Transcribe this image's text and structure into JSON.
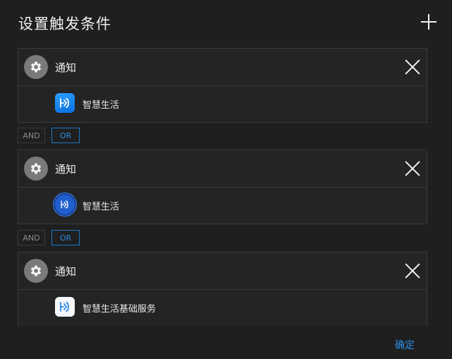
{
  "dialog": {
    "title": "设置触发条件",
    "add_icon": "plus-icon"
  },
  "logic_labels": {
    "and": "AND",
    "or": "OR",
    "selected": "OR"
  },
  "conditions": [
    {
      "type_label": "通知",
      "type_icon": "gear-icon",
      "app_name": "智慧生活",
      "app_icon": "smart-life-app-icon"
    },
    {
      "type_label": "通知",
      "type_icon": "gear-icon",
      "app_name": "智慧生活",
      "app_icon": "smart-life-round-app-icon"
    },
    {
      "type_label": "通知",
      "type_icon": "gear-icon",
      "app_name": "智慧生活基础服务",
      "app_icon": "smart-life-basic-service-app-icon"
    }
  ],
  "footer": {
    "confirm_label": "确定"
  },
  "colors": {
    "background": "#1f1f1f",
    "accent": "#2b8fe6"
  }
}
